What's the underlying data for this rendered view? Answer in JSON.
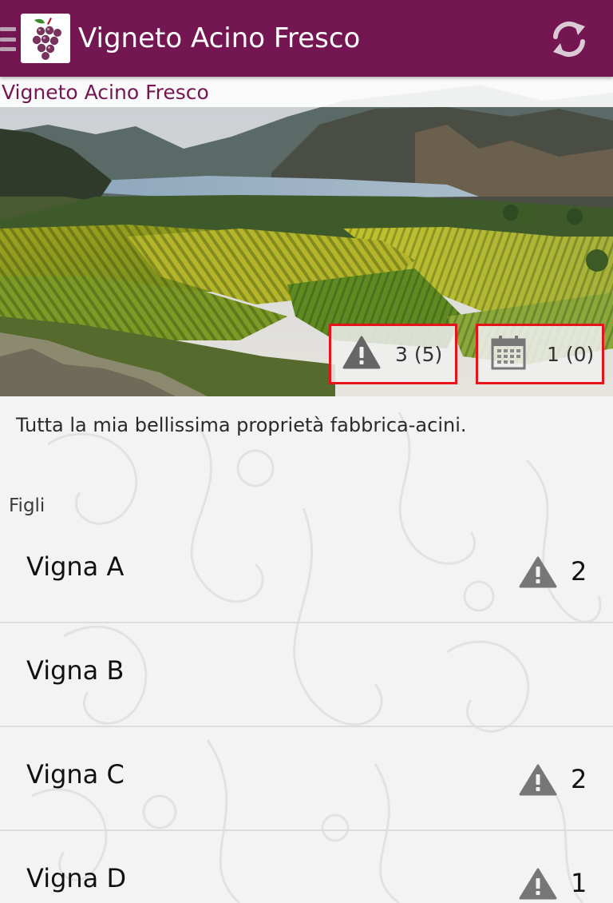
{
  "app_bar": {
    "title": "Vigneto Acino Fresco",
    "brand_color": "#741652",
    "logo_icon": "grapes-icon",
    "refresh_icon": "refresh-icon",
    "menu_icon": "drawer-menu-icon"
  },
  "subtitle": "Vigneto Acino Fresco",
  "hero": {
    "image": "vineyard-valley-landscape",
    "alerts_badge": {
      "icon": "warning-icon",
      "label": "3 (5)"
    },
    "calendar_badge": {
      "icon": "calendar-icon",
      "label": "1 (0)"
    },
    "badge_border_color": "#e8121a"
  },
  "description": "Tutta la mia bellissima proprietà fabbrica-acini.",
  "children": {
    "header": "Figli",
    "items": [
      {
        "name": "Vigna A",
        "alerts": "2"
      },
      {
        "name": "Vigna B",
        "alerts": ""
      },
      {
        "name": "Vigna C",
        "alerts": "2"
      },
      {
        "name": "Vigna D",
        "alerts": "1"
      }
    ]
  }
}
